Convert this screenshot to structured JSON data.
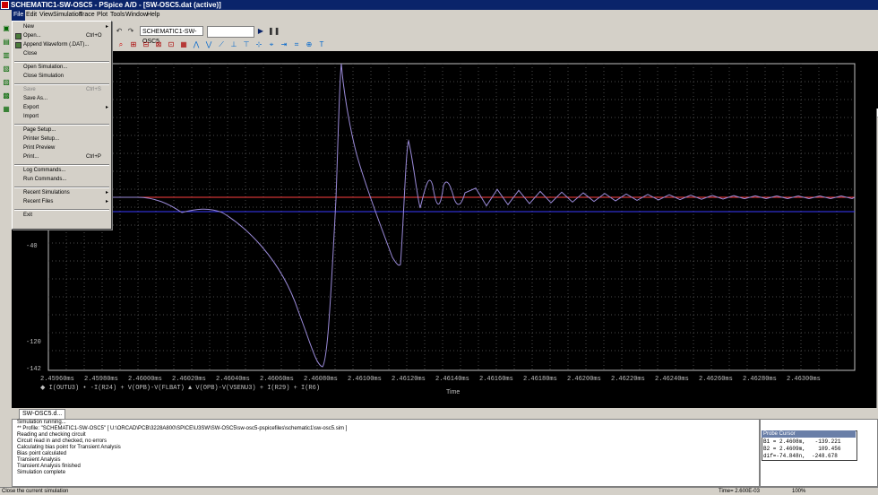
{
  "window": {
    "title": "SCHEMATIC1-SW-OSC5 - PSpice A/D - [SW-OSC5.dat (active)]"
  },
  "menubar": {
    "items": [
      "File",
      "Edit",
      "View",
      "Simulation",
      "Trace",
      "Plot",
      "Tools",
      "Window",
      "Help"
    ]
  },
  "toolbar": {
    "profile_combo": "SCHEMATIC1-SW-OSC5",
    "run_icon": "play-icon",
    "pause_icon": "pause-icon"
  },
  "file_menu": {
    "items": [
      {
        "label": "New",
        "shortcut": "",
        "submenu": true,
        "disabled": false,
        "icon": ""
      },
      {
        "label": "Open...",
        "shortcut": "Ctrl+O",
        "submenu": false,
        "disabled": false,
        "icon": "folder-open-icon"
      },
      {
        "label": "Append Waveform (.DAT)...",
        "shortcut": "",
        "submenu": false,
        "disabled": false,
        "icon": "append-icon"
      },
      {
        "label": "Close",
        "shortcut": "",
        "submenu": false,
        "disabled": false,
        "icon": ""
      },
      {
        "label": "Open Simulation...",
        "shortcut": "",
        "submenu": false,
        "disabled": false,
        "icon": ""
      },
      {
        "label": "Close Simulation",
        "shortcut": "",
        "submenu": false,
        "disabled": false,
        "icon": ""
      },
      {
        "label": "Save",
        "shortcut": "Ctrl+S",
        "submenu": false,
        "disabled": true,
        "icon": ""
      },
      {
        "label": "Save As...",
        "shortcut": "",
        "submenu": false,
        "disabled": false,
        "icon": ""
      },
      {
        "label": "Export",
        "shortcut": "",
        "submenu": true,
        "disabled": false,
        "icon": ""
      },
      {
        "label": "Import",
        "shortcut": "",
        "submenu": false,
        "disabled": false,
        "icon": ""
      },
      {
        "label": "Page Setup...",
        "shortcut": "",
        "submenu": false,
        "disabled": false,
        "icon": ""
      },
      {
        "label": "Printer Setup...",
        "shortcut": "",
        "submenu": false,
        "disabled": false,
        "icon": ""
      },
      {
        "label": "Print Preview",
        "shortcut": "",
        "submenu": false,
        "disabled": false,
        "icon": ""
      },
      {
        "label": "Print...",
        "shortcut": "Ctrl+P",
        "submenu": false,
        "disabled": false,
        "icon": ""
      },
      {
        "label": "Log Commands...",
        "shortcut": "",
        "submenu": false,
        "disabled": false,
        "icon": ""
      },
      {
        "label": "Run Commands...",
        "shortcut": "",
        "submenu": false,
        "disabled": false,
        "icon": ""
      },
      {
        "label": "Recent Simulations",
        "shortcut": "",
        "submenu": true,
        "disabled": false,
        "icon": ""
      },
      {
        "label": "Recent Files",
        "shortcut": "",
        "submenu": true,
        "disabled": false,
        "icon": ""
      },
      {
        "label": "Exit",
        "shortcut": "",
        "submenu": false,
        "disabled": false,
        "icon": ""
      }
    ]
  },
  "chart_data": {
    "type": "line",
    "background": "#000000",
    "grid": true,
    "xlabel": "Time",
    "x_ticks": [
      "2.45960ms",
      "2.45980ms",
      "2.46000ms",
      "2.46020ms",
      "2.46040ms",
      "2.46060ms",
      "2.46080ms",
      "2.46100ms",
      "2.46120ms",
      "2.46140ms",
      "2.46160ms",
      "2.46180ms",
      "2.46200ms",
      "2.46220ms",
      "2.46240ms",
      "2.46260ms",
      "2.46280ms",
      "2.46300ms"
    ],
    "y_ticks": [
      "-40",
      "-120",
      "-142"
    ],
    "xlim_ms": [
      2.4596,
      2.4631
    ],
    "ylim": [
      -142,
      60
    ],
    "series": [
      {
        "name": "I(OUTU3)",
        "color": "#d0d0ff",
        "marker": "diamond"
      },
      {
        "name": "-I(R24) + V(OPB)-V(FLBAT)",
        "color": "#7f7fff",
        "marker": "diamond"
      },
      {
        "name": "V(OPB)-V(VSENU3) + I(R29) + I(R6)",
        "color": "#ff4040",
        "marker": "triangle"
      }
    ],
    "legend_text": "◆ I(OUTU3) • -I(R24) + V(OPB)-V(FLBAT)  ▲ V(OPB)-V(VSENU3) + I(R29) + I(R6)"
  },
  "doc_tab": {
    "label": "SW-OSC5.d..."
  },
  "output_log": [
    "Simulation running...",
    "** Profile: \"SCHEMATIC1-SW-OSC5\"  [ U:\\ORCAD\\PCB\\3228A800\\SPICE\\U3SW\\SW-OSC5\\sw-osc5-pspicefiles\\schematic1\\sw-osc5.sim ]",
    "Reading and checking circuit",
    "Circuit read in and checked, no errors",
    "Calculating bias point for Transient Analysis",
    "Bias point calculated",
    "Transient Analysis",
    "Transient Analysis finished",
    "Simulation complete"
  ],
  "probe_cursor": {
    "title": "Probe Cursor",
    "rows": [
      {
        "label": "B1 =",
        "x": "2.4608m,",
        "y": "-139.221"
      },
      {
        "label": "B2 =",
        "x": "2.4609m,",
        "y": "109.456"
      },
      {
        "label": "dif=",
        "x": "-74.848n,",
        "y": "-248.678"
      }
    ]
  },
  "statusbar": {
    "message": "Close the current simulation",
    "time": "Time= 2.600E-03",
    "zoom": "100%"
  }
}
